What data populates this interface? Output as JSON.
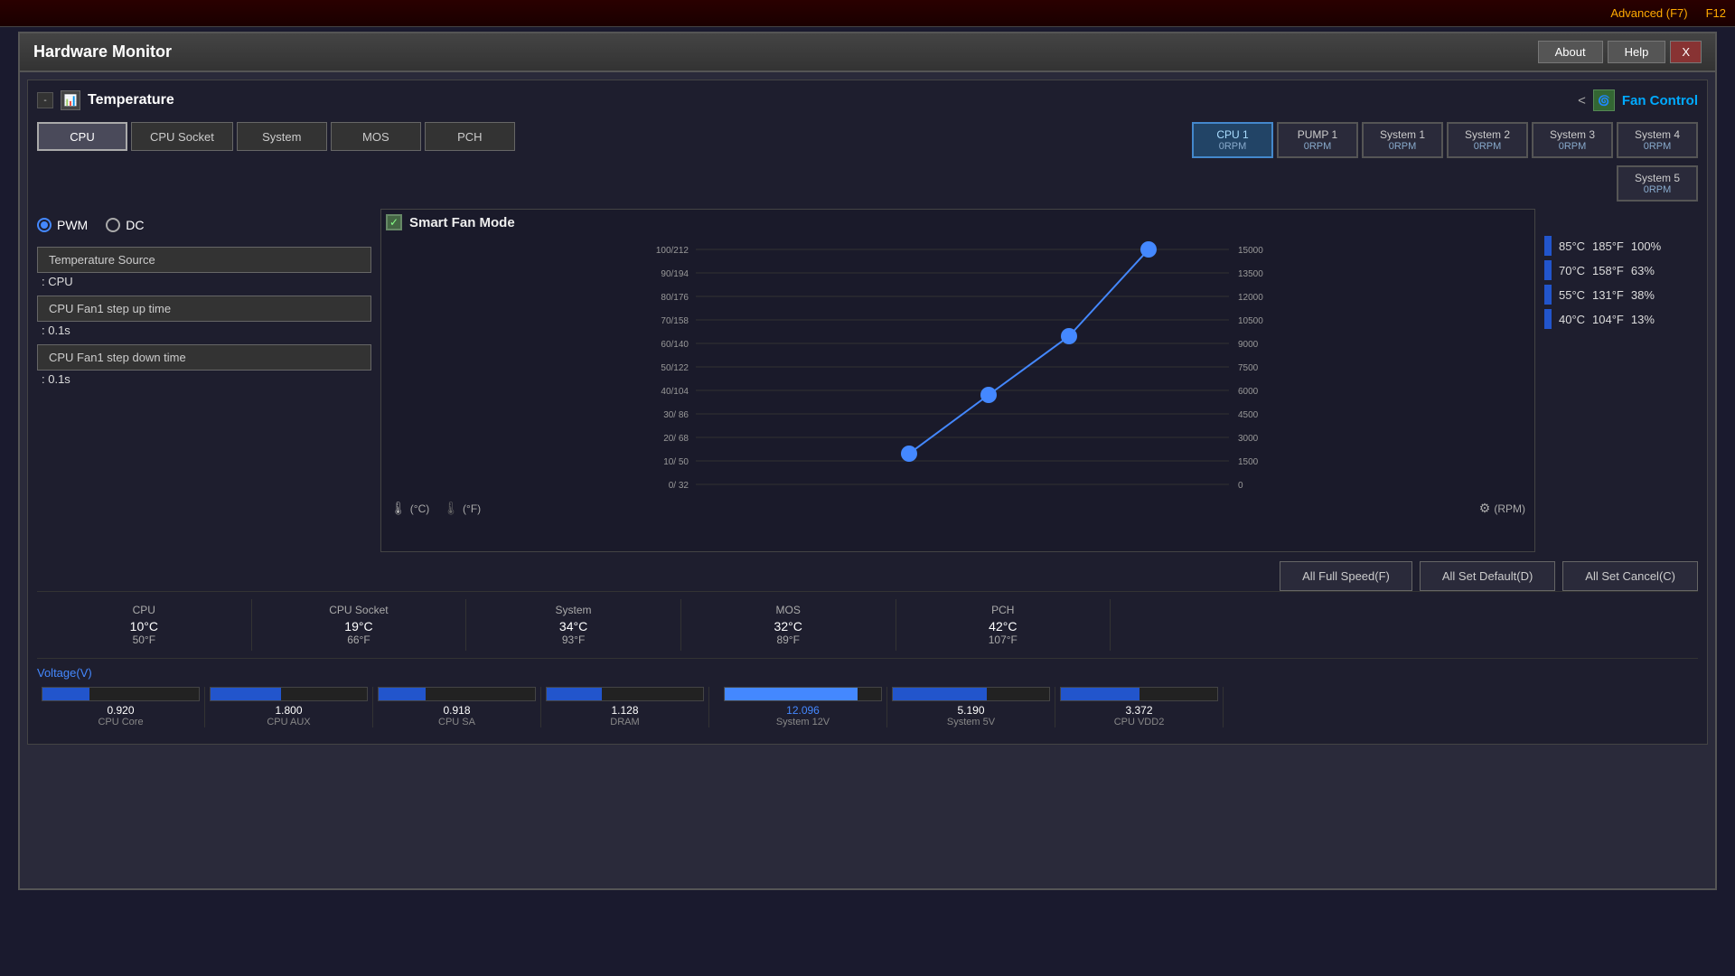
{
  "topbar": {
    "advanced_label": "Advanced (F7)",
    "f12_label": "F12"
  },
  "window": {
    "title": "Hardware Monitor",
    "about_btn": "About",
    "help_btn": "Help",
    "close_btn": "X"
  },
  "temperature_section": {
    "title": "Temperature",
    "collapse": "-",
    "nav_arrow": "<",
    "fan_control_label": "Fan Control"
  },
  "temp_source_buttons": [
    {
      "label": "CPU",
      "active": true
    },
    {
      "label": "CPU Socket",
      "active": false
    },
    {
      "label": "System",
      "active": false
    },
    {
      "label": "MOS",
      "active": false
    },
    {
      "label": "PCH",
      "active": false
    }
  ],
  "fan_speed_buttons": [
    {
      "label": "CPU 1",
      "rpm": "0RPM",
      "active": true
    },
    {
      "label": "PUMP 1",
      "rpm": "0RPM",
      "active": false
    },
    {
      "label": "System 1",
      "rpm": "0RPM",
      "active": false
    },
    {
      "label": "System 2",
      "rpm": "0RPM",
      "active": false
    },
    {
      "label": "System 3",
      "rpm": "0RPM",
      "active": false
    },
    {
      "label": "System 4",
      "rpm": "0RPM",
      "active": false
    },
    {
      "label": "System 5",
      "rpm": "0RPM",
      "active": false
    }
  ],
  "left_panel": {
    "pwm_label": "PWM",
    "dc_label": "DC",
    "pwm_active": true,
    "temp_source_label": "Temperature Source",
    "temp_source_value": ": CPU",
    "step_up_label": "CPU Fan1 step up time",
    "step_up_value": ": 0.1s",
    "step_down_label": "CPU Fan1 step down time",
    "step_down_value": ": 0.1s"
  },
  "chart": {
    "smart_fan_title": "Smart Fan Mode",
    "checked": "✓",
    "y_labels_left": [
      "100/212",
      "90/194",
      "80/176",
      "70/158",
      "60/140",
      "50/122",
      "40/104",
      "30/ 86",
      "20/ 68",
      "10/ 50",
      "0/ 32"
    ],
    "y_labels_right": [
      "15000",
      "13500",
      "12000",
      "10500",
      "9000",
      "7500",
      "6000",
      "4500",
      "3000",
      "1500",
      "0"
    ],
    "celsius_label": "(°C)",
    "fahrenheit_label": "(°F)",
    "rpm_label": "(RPM)"
  },
  "legend": [
    {
      "temp_c": "85°C",
      "temp_f": "185°F",
      "pct": "100%"
    },
    {
      "temp_c": "70°C",
      "temp_f": "158°F",
      "pct": "63%"
    },
    {
      "temp_c": "55°C",
      "temp_f": "131°F",
      "pct": "38%"
    },
    {
      "temp_c": "40°C",
      "temp_f": "104°F",
      "pct": "13%"
    }
  ],
  "bottom_buttons": [
    {
      "label": "All Full Speed(F)"
    },
    {
      "label": "All Set Default(D)"
    },
    {
      "label": "All Set Cancel(C)"
    }
  ],
  "sensors": [
    {
      "name": "CPU",
      "c": "10°C",
      "f": "50°F"
    },
    {
      "name": "CPU Socket",
      "c": "19°C",
      "f": "66°F"
    },
    {
      "name": "System",
      "c": "34°C",
      "f": "93°F"
    },
    {
      "name": "MOS",
      "c": "32°C",
      "f": "89°F"
    },
    {
      "name": "PCH",
      "c": "42°C",
      "f": "107°F"
    }
  ],
  "voltage_title": "Voltage(V)",
  "voltages": [
    {
      "label": "CPU Core",
      "value": "0.920",
      "pct": 30,
      "highlight": false
    },
    {
      "label": "CPU AUX",
      "value": "1.800",
      "pct": 45,
      "highlight": false
    },
    {
      "label": "CPU SA",
      "value": "0.918",
      "pct": 30,
      "highlight": false
    },
    {
      "label": "DRAM",
      "value": "1.128",
      "pct": 35,
      "highlight": false
    },
    {
      "label": "System 12V",
      "value": "12.096",
      "pct": 85,
      "highlight": true
    },
    {
      "label": "System 5V",
      "value": "5.190",
      "pct": 70,
      "highlight": false
    },
    {
      "label": "CPU VDD2",
      "value": "3.372",
      "pct": 55,
      "highlight": false
    }
  ]
}
